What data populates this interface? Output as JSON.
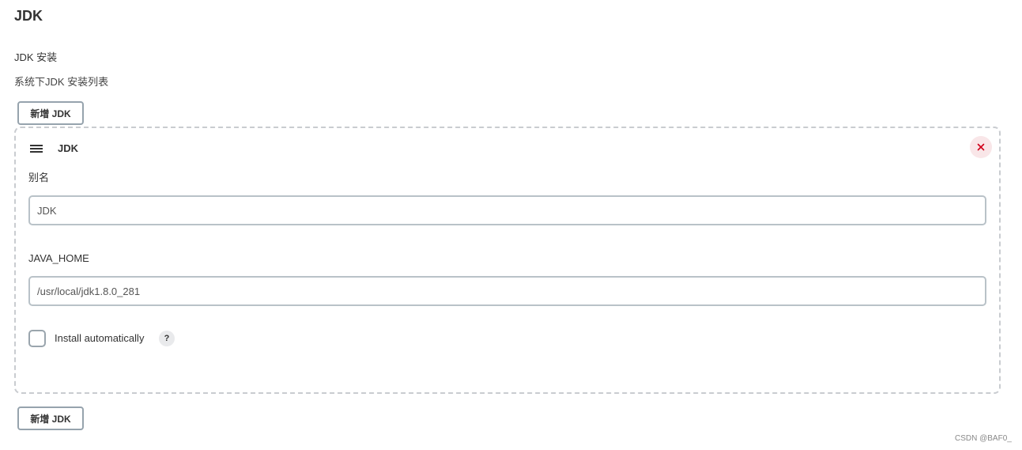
{
  "section": {
    "title": "JDK",
    "install_label": "JDK 安装",
    "description": "系统下JDK 安装列表"
  },
  "add_button_top": {
    "label": "新增 JDK"
  },
  "jdk_entry": {
    "title": "JDK",
    "drag_icon": "drag-handle-icon",
    "delete_icon": "close-icon",
    "delete_color": "#d0021b",
    "alias": {
      "label": "别名",
      "value": "JDK"
    },
    "java_home": {
      "label": "JAVA_HOME",
      "value": "/usr/local/jdk1.8.0_281"
    },
    "install_automatically": {
      "label": "Install automatically",
      "checked": false,
      "help_icon": "?"
    }
  },
  "add_button_bottom": {
    "label": "新增 JDK"
  },
  "watermark": "CSDN @BAF0_"
}
